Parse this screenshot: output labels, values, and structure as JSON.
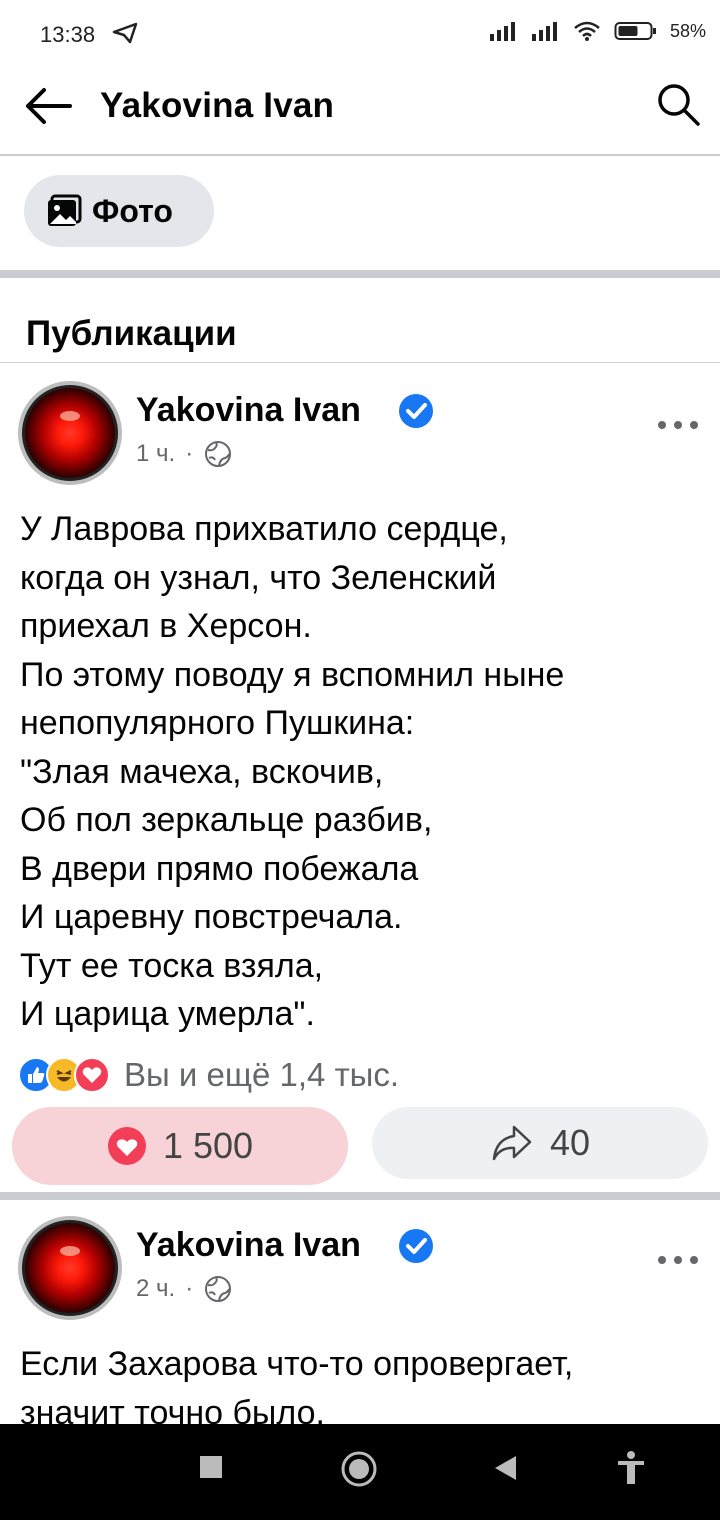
{
  "status_bar": {
    "time": "13:38",
    "battery": "58%"
  },
  "header": {
    "title": "Yakovina Ivan"
  },
  "chips": {
    "photo_label": "Фото"
  },
  "section": {
    "title": "Публикации"
  },
  "posts": [
    {
      "author": "Yakovina Ivan",
      "time": "1 ч.",
      "text": "У Лаврова прихватило сердце,\nкогда он узнал, что Зеленский\nприехал в Херсон.\nПо этому поводу я вспомнил ныне\nнепопулярного Пушкина:\n\"Злая мачеха, вскочив,\nОб пол зеркальце разбив,\nВ двери прямо побежала\nИ царевну повстречала.\nТут ее тоска взяла,\nИ царица умерла\".",
      "reactions_summary": "Вы и ещё 1,4 тыс.",
      "like_count": "1 500",
      "share_count": "40"
    },
    {
      "author": "Yakovina Ivan",
      "time": "2 ч.",
      "text": "Если Захарова что-то опровергает,\nзначит точно было."
    }
  ],
  "colors": {
    "verified_blue": "#1877f2",
    "love_red": "#f33e58",
    "like_pill_bg": "#f7d3d7",
    "muted_text": "#65676b"
  },
  "icons": [
    "telegram-send-icon",
    "signal-icon",
    "wifi-icon",
    "battery-icon",
    "back-arrow-icon",
    "search-icon",
    "photo-icon",
    "verified-badge-icon",
    "globe-icon",
    "more-dots-icon",
    "like-reaction-icon",
    "haha-reaction-icon",
    "love-reaction-icon",
    "heart-icon",
    "share-icon",
    "recent-apps-icon",
    "home-icon",
    "back-triangle-icon",
    "accessibility-icon"
  ]
}
